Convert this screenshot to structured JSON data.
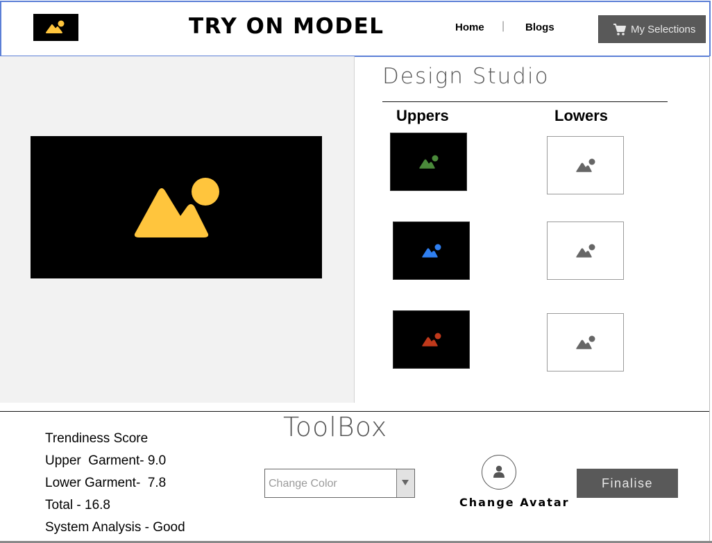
{
  "header": {
    "logo_icon": "image-icon",
    "title": "TRY ON MODEL",
    "nav": {
      "home": "Home",
      "separator": "|",
      "blogs": "Blogs"
    },
    "selections_button": {
      "label": "My Selections",
      "icon": "cart-icon"
    }
  },
  "preview": {
    "icon": "image-icon",
    "icon_color": "#ffc53d"
  },
  "studio": {
    "title": "Design Studio",
    "uppers_heading": "Uppers",
    "lowers_heading": "Lowers",
    "uppers": [
      {
        "icon": "image-icon",
        "icon_color": "#4a8a3a",
        "background": "#000000"
      },
      {
        "icon": "image-icon",
        "icon_color": "#2f7ff0",
        "background": "#000000"
      },
      {
        "icon": "image-icon",
        "icon_color": "#c0391b",
        "background": "#000000"
      }
    ],
    "lowers": [
      {
        "icon": "image-icon",
        "icon_color": "#666666",
        "background": "#ffffff"
      },
      {
        "icon": "image-icon",
        "icon_color": "#666666",
        "background": "#ffffff"
      },
      {
        "icon": "image-icon",
        "icon_color": "#666666",
        "background": "#ffffff"
      }
    ]
  },
  "toolbox": {
    "title": "ToolBox",
    "scores": {
      "title": "Trendiness Score",
      "upper": "Upper  Garment- 9.0",
      "lower": "Lower Garment-  7.8",
      "total": "Total - 16.8",
      "analysis": "System Analysis - Good"
    },
    "color_select": {
      "placeholder": "Change Color"
    },
    "avatar": {
      "label": "Change Avatar",
      "icon": "user-icon"
    },
    "finalise_label": "Finalise"
  },
  "colors": {
    "header_border": "#5b7fd6",
    "button_bg": "#595959",
    "panel_bg": "#f2f2f2"
  }
}
